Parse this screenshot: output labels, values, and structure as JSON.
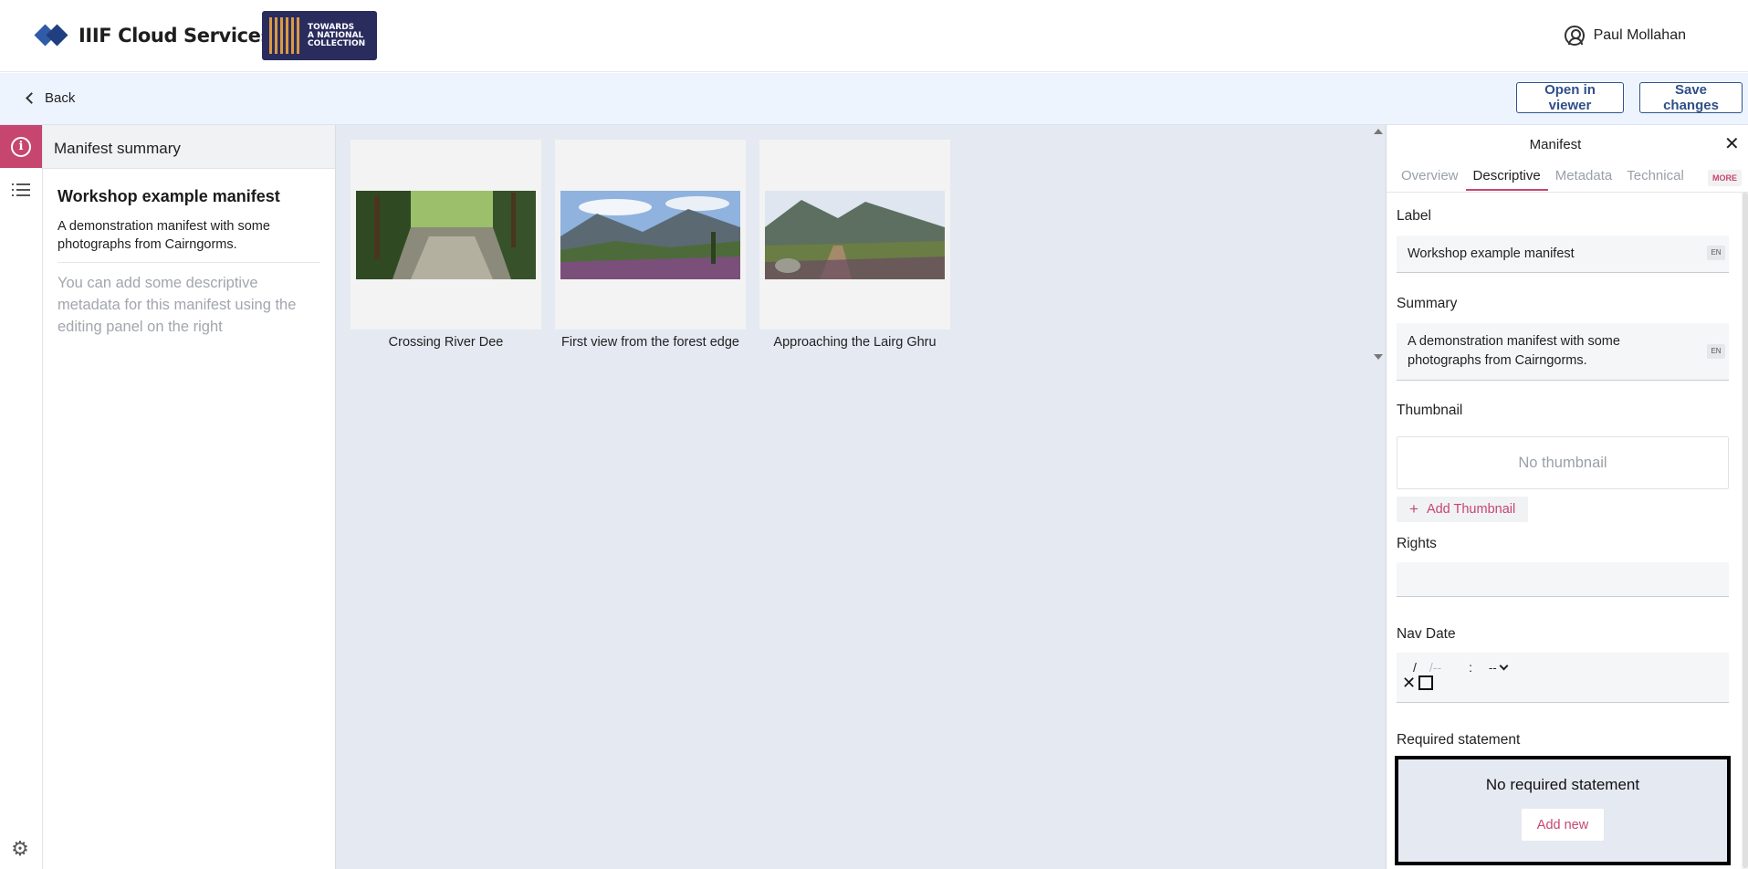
{
  "header": {
    "brand": "IIIF Cloud Services",
    "partner_logo": "TOWARDS A NATIONAL COLLECTION",
    "partner_lines": [
      "TOWARDS",
      "A NATIONAL",
      "COLLECTION"
    ],
    "user_name": "Paul Mollahan",
    "user_icon": "user-circle-icon"
  },
  "toolbar": {
    "back_label": "Back",
    "open_viewer_label": "Open in viewer",
    "save_label": "Save changes"
  },
  "rail": {
    "info_icon": "info-icon",
    "list_icon": "list-icon",
    "settings_icon": "gear-icon"
  },
  "summary": {
    "panel_title": "Manifest summary",
    "manifest_title": "Workshop example manifest",
    "description": "A demonstration manifest with some photographs from Cairngorms.",
    "hint": "You can add some descriptive metadata for this manifest using the editing panel on the right"
  },
  "canvases": [
    {
      "label": "Crossing River Dee"
    },
    {
      "label": "First view from the forest edge"
    },
    {
      "label": "Approaching the Lairg Ghru"
    }
  ],
  "editor": {
    "title": "Manifest",
    "tabs": [
      "Overview",
      "Descriptive",
      "Metadata",
      "Technical"
    ],
    "active_tab": "Descriptive",
    "more_label": "MORE",
    "label_heading": "Label",
    "label_value": "Workshop example manifest",
    "summary_heading": "Summary",
    "summary_value": "A demonstration manifest with some photographs from Cairngorms.",
    "lang_tag": "EN",
    "thumbnail_heading": "Thumbnail",
    "no_thumbnail": "No thumbnail",
    "add_thumbnail_label": "Add Thumbnail",
    "rights_heading": "Rights",
    "rights_value": "",
    "nav_date_heading": "Nav Date",
    "nav_date_sep1": "/",
    "nav_date_sep2": "/--",
    "nav_time_sep": ":",
    "nav_ampm": "--",
    "required_heading": "Required statement",
    "no_required": "No required statement",
    "add_new_label": "Add new"
  },
  "colors": {
    "accent": "#c6466f",
    "primary_button": "#2f4f89",
    "toolbar_bg": "#eef4fe",
    "canvas_bg": "#e5e9f2"
  }
}
